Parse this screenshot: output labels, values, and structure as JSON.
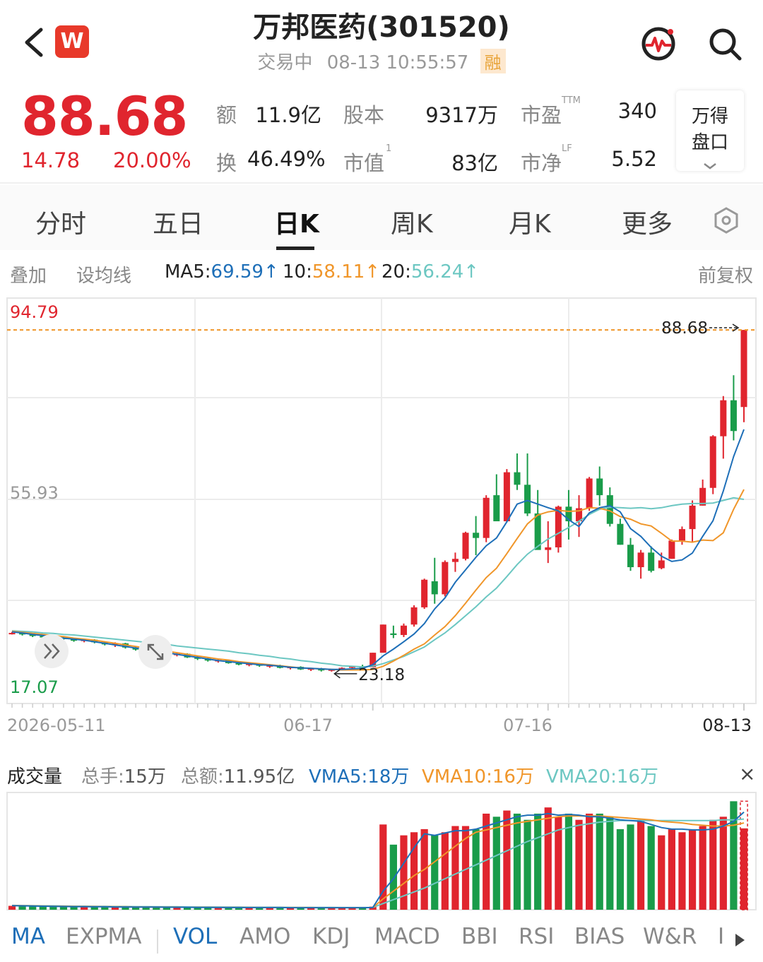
{
  "header": {
    "title": "万邦医药(301520)",
    "status": "交易中",
    "datetime": "08-13 10:55:57",
    "margin_badge": "融",
    "logo_letter": "W"
  },
  "quote": {
    "price": "88.68",
    "change": "14.78",
    "change_pct": "20.00%",
    "stats": [
      {
        "label": "额",
        "value": "11.9亿"
      },
      {
        "label": "股本",
        "value": "9317万"
      },
      {
        "label": "市盈",
        "sup": "TTM",
        "value": "340"
      },
      {
        "label": "换",
        "value": "46.49%"
      },
      {
        "label": "市值",
        "sup": "1",
        "value": "83亿"
      },
      {
        "label": "市净",
        "sup": "LF",
        "value": "5.52"
      }
    ],
    "pankou_line1": "万得",
    "pankou_line2": "盘口",
    "color_up": "#e0252e",
    "color_down": "#1a9c4a"
  },
  "tabs": [
    "分时",
    "五日",
    "日K",
    "周K",
    "月K",
    "更多"
  ],
  "active_tab": "日K",
  "ma_row": {
    "overlay": "叠加",
    "set_ma": "设均线",
    "ma5_label": "MA5:",
    "ma5_value": "69.59",
    "ma10_label": "10:",
    "ma10_value": "58.11",
    "ma20_label": "20:",
    "ma20_value": "56.24",
    "arrow": "↑",
    "adjust": "前复权",
    "ma5_color": "#1e6fb8",
    "ma10_color": "#f0962a",
    "ma20_color": "#6cc7c2"
  },
  "chart_data": {
    "type": "candlestick",
    "price_axis": {
      "max": "94.79",
      "mid": "55.93",
      "min": "17.07",
      "ylim": [
        17.07,
        94.79
      ]
    },
    "last_price_label": "88.68",
    "low_marker_label": "23.18",
    "x_labels": [
      "2026-05-11",
      "06-17",
      "07-16",
      "08-13"
    ],
    "candles": [
      [
        30.5,
        30.8,
        30.3,
        30.6
      ],
      [
        30.6,
        30.9,
        30.1,
        30.3
      ],
      [
        30.3,
        30.5,
        29.8,
        30.0
      ],
      [
        30.0,
        30.2,
        29.6,
        29.8
      ],
      [
        29.8,
        30.1,
        29.5,
        29.7
      ],
      [
        29.7,
        29.9,
        29.2,
        29.4
      ],
      [
        29.4,
        29.6,
        28.9,
        29.1
      ],
      [
        29.1,
        29.5,
        28.8,
        29.3
      ],
      [
        29.3,
        29.4,
        28.6,
        28.8
      ],
      [
        28.8,
        29.0,
        28.2,
        28.4
      ],
      [
        28.4,
        28.8,
        27.9,
        28.6
      ],
      [
        28.6,
        28.7,
        27.6,
        27.8
      ],
      [
        27.8,
        28.0,
        27.2,
        27.4
      ],
      [
        27.4,
        27.6,
        26.9,
        27.2
      ],
      [
        27.2,
        27.5,
        26.6,
        26.8
      ],
      [
        26.8,
        27.0,
        26.2,
        26.5
      ],
      [
        26.5,
        26.9,
        26.1,
        26.6
      ],
      [
        26.6,
        26.7,
        25.8,
        25.9
      ],
      [
        25.9,
        26.1,
        25.4,
        25.7
      ],
      [
        25.7,
        25.9,
        25.1,
        25.3
      ],
      [
        25.3,
        25.6,
        24.9,
        25.4
      ],
      [
        25.4,
        25.5,
        24.7,
        24.8
      ],
      [
        24.8,
        25.0,
        24.4,
        24.6
      ],
      [
        24.6,
        24.9,
        24.2,
        24.7
      ],
      [
        24.7,
        24.8,
        24.1,
        24.3
      ],
      [
        24.3,
        24.6,
        23.9,
        24.4
      ],
      [
        24.4,
        24.5,
        23.8,
        23.9
      ],
      [
        23.9,
        24.2,
        23.6,
        24.1
      ],
      [
        24.1,
        24.2,
        23.5,
        23.6
      ],
      [
        23.6,
        23.9,
        23.3,
        23.8
      ],
      [
        23.8,
        23.9,
        23.2,
        23.4
      ],
      [
        23.4,
        23.7,
        23.18,
        23.6
      ],
      [
        23.6,
        24.0,
        23.4,
        23.9
      ],
      [
        23.9,
        24.3,
        23.7,
        24.2
      ],
      [
        24.2,
        24.5,
        23.9,
        24.0
      ],
      [
        24.0,
        26.8,
        24.0,
        26.8
      ],
      [
        26.8,
        32.2,
        26.8,
        32.2
      ],
      [
        30.5,
        32.0,
        29.6,
        30.2
      ],
      [
        30.2,
        32.4,
        29.8,
        32.0
      ],
      [
        32.2,
        35.9,
        31.8,
        35.5
      ],
      [
        35.5,
        41.0,
        35.2,
        40.8
      ],
      [
        40.5,
        45.0,
        36.2,
        38.0
      ],
      [
        38.0,
        44.5,
        37.6,
        44.2
      ],
      [
        44.2,
        46.0,
        42.3,
        44.8
      ],
      [
        44.8,
        50.0,
        44.5,
        49.8
      ],
      [
        49.8,
        53.0,
        45.5,
        48.8
      ],
      [
        48.8,
        57.0,
        48.0,
        56.5
      ],
      [
        57.0,
        61.0,
        52.0,
        52.0
      ],
      [
        52.0,
        62.0,
        51.8,
        61.4
      ],
      [
        61.4,
        65.0,
        58.0,
        59.0
      ],
      [
        59.0,
        65.0,
        53.0,
        53.5
      ],
      [
        53.5,
        58.0,
        47.0,
        46.5
      ],
      [
        46.5,
        52.0,
        44.0,
        47.0
      ],
      [
        47.0,
        55.0,
        46.0,
        54.8
      ],
      [
        54.8,
        58.0,
        48.5,
        52.0
      ],
      [
        52.0,
        57.0,
        49.0,
        54.5
      ],
      [
        54.5,
        60.5,
        54.0,
        60.2
      ],
      [
        60.2,
        62.5,
        55.0,
        57.0
      ],
      [
        57.0,
        58.5,
        51.0,
        51.5
      ],
      [
        51.5,
        52.5,
        47.5,
        47.5
      ],
      [
        47.5,
        48.8,
        42.5,
        43.2
      ],
      [
        43.2,
        46.5,
        41.0,
        46.0
      ],
      [
        46.0,
        47.2,
        42.2,
        42.5
      ],
      [
        43.0,
        46.0,
        42.8,
        44.5
      ],
      [
        44.8,
        48.5,
        44.8,
        48.3
      ],
      [
        48.3,
        51.0,
        47.5,
        50.5
      ],
      [
        50.5,
        56.0,
        48.0,
        55.0
      ],
      [
        55.0,
        60.0,
        55.0,
        58.4
      ],
      [
        58.4,
        68.5,
        57.2,
        68.3
      ],
      [
        68.3,
        76.0,
        64.0,
        75.2
      ],
      [
        75.2,
        80.0,
        67.5,
        69.3
      ],
      [
        73.9,
        88.68,
        71.0,
        88.68
      ]
    ],
    "ma5": [
      30.8,
      30.6,
      30.3,
      30.1,
      29.9,
      29.6,
      29.4,
      29.2,
      28.9,
      28.6,
      28.3,
      28.0,
      27.7,
      27.4,
      27.1,
      26.8,
      26.5,
      26.2,
      25.9,
      25.6,
      25.3,
      25.1,
      24.9,
      24.7,
      24.5,
      24.4,
      24.2,
      24.0,
      23.9,
      23.8,
      23.7,
      23.6,
      23.6,
      23.7,
      23.8,
      24.5,
      26.2,
      27.5,
      28.9,
      30.4,
      32.4,
      35.2,
      37.3,
      40.3,
      42.7,
      45.1,
      47.3,
      48.8,
      51.9,
      55.3,
      56.0,
      55.3,
      54.6,
      54.0,
      52.3,
      51.0,
      53.6,
      54.6,
      55.0,
      53.8,
      50.6,
      49.1,
      47.0,
      45.3,
      44.3,
      44.6,
      45.9,
      49.1,
      52.1,
      57.8,
      64.4,
      69.6
    ],
    "ma10": [
      30.9,
      30.7,
      30.5,
      30.3,
      30.1,
      29.9,
      29.6,
      29.4,
      29.2,
      28.9,
      28.6,
      28.3,
      28.0,
      27.7,
      27.4,
      27.1,
      26.8,
      26.5,
      26.2,
      25.9,
      25.6,
      25.4,
      25.1,
      24.9,
      24.7,
      24.5,
      24.3,
      24.1,
      23.9,
      23.8,
      23.7,
      23.6,
      23.5,
      23.5,
      23.5,
      23.6,
      24.2,
      25.2,
      26.3,
      27.5,
      28.5,
      30.2,
      31.8,
      33.9,
      36.3,
      38.8,
      41.2,
      43.0,
      45.8,
      48.7,
      51.5,
      53.2,
      53.8,
      54.1,
      53.9,
      54.0,
      54.6,
      54.5,
      54.0,
      52.9,
      52.4,
      51.5,
      51.1,
      49.7,
      48.2,
      48.2,
      48.0,
      48.4,
      48.3,
      49.8,
      54.3,
      58.1
    ],
    "ma20": [
      31.0,
      30.9,
      30.8,
      30.6,
      30.5,
      30.3,
      30.2,
      30.0,
      29.8,
      29.6,
      29.4,
      29.2,
      29.0,
      28.8,
      28.6,
      28.4,
      28.1,
      27.9,
      27.7,
      27.5,
      27.3,
      27.1,
      26.8,
      26.6,
      26.3,
      26.1,
      25.8,
      25.6,
      25.3,
      25.1,
      24.8,
      24.6,
      24.3,
      24.2,
      24.1,
      24.2,
      24.7,
      25.4,
      26.1,
      27.0,
      27.9,
      29.3,
      30.6,
      32.2,
      33.9,
      35.6,
      37.5,
      39.2,
      41.4,
      43.7,
      45.7,
      47.2,
      48.6,
      49.7,
      50.8,
      52.0,
      53.3,
      54.3,
      54.7,
      54.6,
      54.5,
      54.6,
      54.4,
      54.6,
      55.0,
      55.3,
      55.4,
      55.4,
      55.5,
      56.0,
      56.5,
      56.2
    ],
    "volume": [
      2.5,
      2.4,
      2.2,
      2.1,
      2.0,
      2.0,
      1.9,
      1.9,
      1.8,
      1.8,
      1.7,
      1.7,
      1.7,
      1.6,
      1.6,
      1.6,
      1.5,
      1.5,
      1.5,
      1.5,
      1.4,
      1.4,
      1.4,
      1.4,
      1.4,
      1.3,
      1.3,
      1.3,
      1.3,
      1.3,
      1.3,
      1.3,
      1.3,
      1.3,
      1.4,
      2.0,
      55.0,
      42.0,
      48.0,
      50.0,
      52.0,
      48.0,
      50.0,
      54.0,
      54.0,
      52.0,
      62.0,
      60.0,
      64.0,
      62.0,
      58.0,
      62.0,
      66.0,
      60.0,
      62.0,
      58.0,
      62.0,
      62.0,
      60.0,
      52.0,
      55.0,
      58.0,
      54.0,
      48.0,
      52.0,
      50.0,
      52.0,
      54.0,
      58.0,
      60.0,
      70.0,
      70.0
    ],
    "vma5": [
      2.6,
      2.5,
      2.4,
      2.3,
      2.2,
      2.1,
      2.0,
      2.0,
      1.9,
      1.9,
      1.8,
      1.8,
      1.7,
      1.7,
      1.7,
      1.6,
      1.6,
      1.6,
      1.5,
      1.5,
      1.5,
      1.4,
      1.4,
      1.4,
      1.4,
      1.4,
      1.4,
      1.3,
      1.3,
      1.3,
      1.3,
      1.3,
      1.3,
      1.3,
      1.3,
      1.4,
      12.0,
      20.0,
      30.0,
      40.0,
      49.0,
      48.0,
      49.5,
      51.0,
      51.0,
      52.0,
      54.0,
      56.0,
      58.0,
      60.0,
      61.0,
      61.0,
      62.0,
      61.0,
      61.5,
      61.0,
      60.0,
      60.0,
      59.0,
      58.0,
      57.5,
      57.0,
      55.0,
      53.0,
      52.0,
      52.0,
      51.5,
      51.5,
      52.0,
      54.0,
      57.0,
      63.0
    ],
    "vma10": [
      2.7,
      2.6,
      2.5,
      2.4,
      2.3,
      2.3,
      2.2,
      2.1,
      2.1,
      2.0,
      1.9,
      1.9,
      1.8,
      1.8,
      1.7,
      1.7,
      1.7,
      1.6,
      1.6,
      1.6,
      1.5,
      1.5,
      1.5,
      1.5,
      1.4,
      1.4,
      1.4,
      1.4,
      1.4,
      1.4,
      1.3,
      1.3,
      1.3,
      1.3,
      1.3,
      1.4,
      7.0,
      12.0,
      17.0,
      22.0,
      26.0,
      31.0,
      36.0,
      41.0,
      46.0,
      50.0,
      51.5,
      53.0,
      54.5,
      56.0,
      57.0,
      58.0,
      59.0,
      60.0,
      60.5,
      60.5,
      60.5,
      60.5,
      60.0,
      59.5,
      59.0,
      58.5,
      58.0,
      57.0,
      56.5,
      56.0,
      55.0,
      54.5,
      54.0,
      54.0,
      54.5,
      56.0
    ],
    "vma20": [
      2.8,
      2.7,
      2.6,
      2.5,
      2.5,
      2.4,
      2.3,
      2.3,
      2.2,
      2.2,
      2.1,
      2.1,
      2.0,
      2.0,
      1.9,
      1.9,
      1.9,
      1.8,
      1.8,
      1.8,
      1.7,
      1.7,
      1.7,
      1.6,
      1.6,
      1.6,
      1.6,
      1.5,
      1.5,
      1.5,
      1.5,
      1.5,
      1.4,
      1.4,
      1.4,
      1.5,
      4.0,
      6.5,
      9.0,
      11.5,
      14.0,
      17.0,
      20.0,
      23.0,
      26.0,
      29.0,
      32.0,
      35.0,
      38.0,
      41.0,
      44.0,
      46.5,
      49.0,
      51.5,
      53.0,
      54.5,
      55.5,
      56.5,
      57.0,
      57.5,
      57.5,
      57.5,
      57.5,
      57.5,
      57.5,
      57.5,
      57.5,
      57.5,
      57.5,
      58.0,
      58.0,
      58.5
    ]
  },
  "volume_row": {
    "title": "成交量",
    "total_hands_label": "总手:",
    "total_hands": "15万",
    "total_amount_label": "总额:",
    "total_amount": "11.95亿",
    "vma5": "VMA5:18万",
    "vma10": "VMA10:16万",
    "vma20": "VMA20:16万",
    "close": "×"
  },
  "indicator_tabs": [
    "MA",
    "EXPMA",
    "VOL",
    "AMO",
    "KDJ",
    "MACD",
    "BBI",
    "RSI",
    "BIAS",
    "W&R",
    "I"
  ],
  "active_indicators": [
    "MA",
    "VOL"
  ]
}
